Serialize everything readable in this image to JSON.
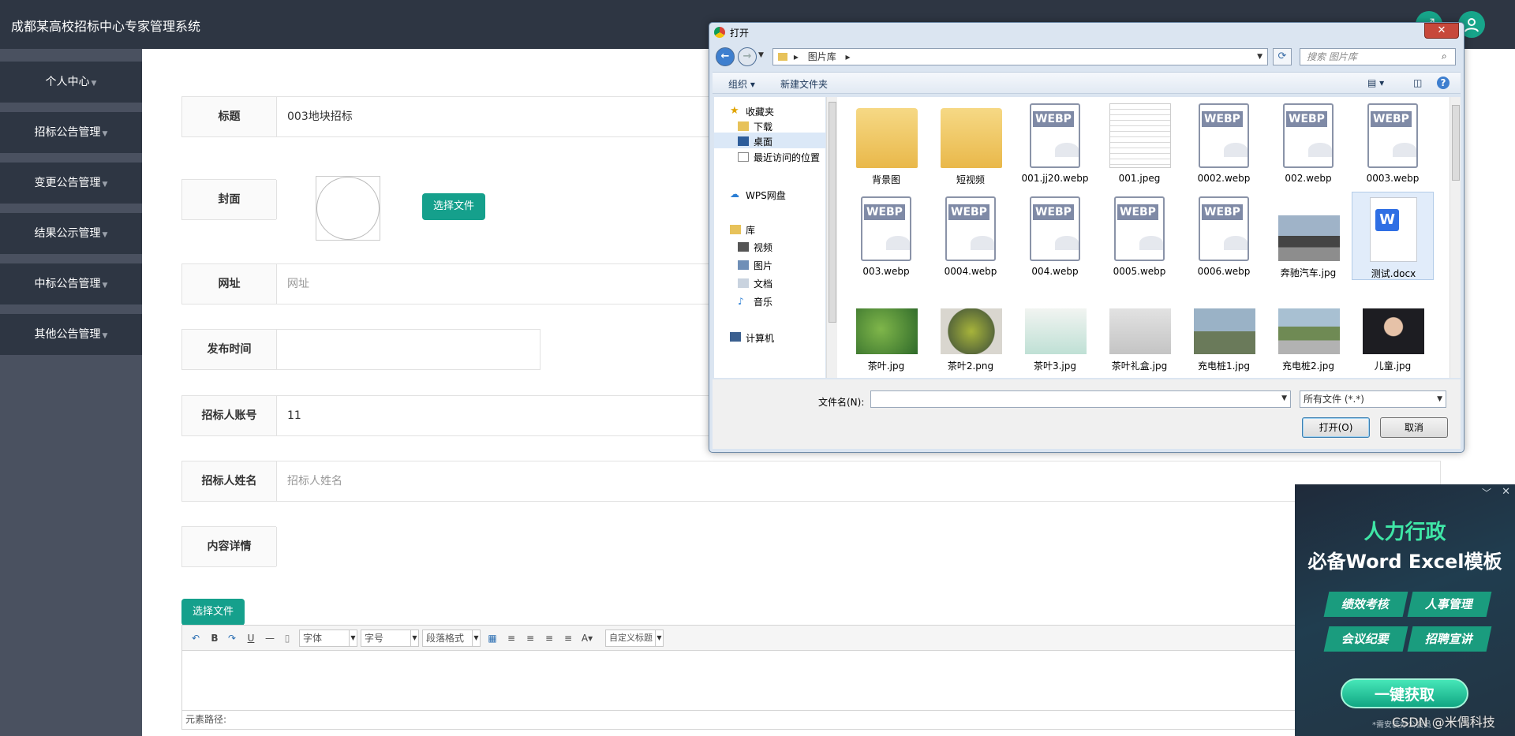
{
  "app": {
    "title": "成都某高校招标中心专家管理系统"
  },
  "sidebar": {
    "items": [
      {
        "label": "个人中心"
      },
      {
        "label": "招标公告管理"
      },
      {
        "label": "变更公告管理"
      },
      {
        "label": "结果公示管理"
      },
      {
        "label": "中标公告管理"
      },
      {
        "label": "其他公告管理"
      }
    ]
  },
  "form": {
    "title": {
      "label": "标题",
      "value": "003地块招标"
    },
    "cover": {
      "label": "封面",
      "button": "选择文件"
    },
    "url": {
      "label": "网址",
      "placeholder": "网址"
    },
    "publish_time": {
      "label": "发布时间",
      "value": ""
    },
    "account": {
      "label": "招标人账号",
      "value": "11"
    },
    "name": {
      "label": "招标人姓名",
      "placeholder": "招标人姓名"
    },
    "content": {
      "label": "内容详情",
      "button": "选择文件"
    }
  },
  "editor": {
    "font_select": "字体",
    "size_select": "字号",
    "para_select": "段落格式",
    "custom_select": "自定义标题",
    "footer": "元素路径:"
  },
  "dialog": {
    "title": "打开",
    "close": "✕",
    "breadcrumb": "图片库",
    "search_placeholder": "搜索 图片库",
    "organize": "组织 ▾",
    "new_folder": "新建文件夹",
    "nav": {
      "favorites": "收藏夹",
      "downloads": "下载",
      "desktop": "桌面",
      "recent": "最近访问的位置",
      "wps": "WPS网盘",
      "library": "库",
      "videos": "视频",
      "pictures": "图片",
      "documents": "文档",
      "music": "音乐",
      "computer": "计算机"
    },
    "files": [
      {
        "name": "背景图",
        "kind": "folder"
      },
      {
        "name": "短视频",
        "kind": "folder"
      },
      {
        "name": "001.jj20.webp",
        "kind": "webp"
      },
      {
        "name": "001.jpeg",
        "kind": "doc-image"
      },
      {
        "name": "0002.webp",
        "kind": "webp"
      },
      {
        "name": "002.webp",
        "kind": "webp"
      },
      {
        "name": "0003.webp",
        "kind": "webp"
      },
      {
        "name": "003.webp",
        "kind": "webp"
      },
      {
        "name": "0004.webp",
        "kind": "webp"
      },
      {
        "name": "004.webp",
        "kind": "webp"
      },
      {
        "name": "0005.webp",
        "kind": "webp"
      },
      {
        "name": "0006.webp",
        "kind": "webp"
      },
      {
        "name": "奔驰汽车.jpg",
        "kind": "photo-car"
      },
      {
        "name": "测试.docx",
        "kind": "word"
      },
      {
        "name": "茶叶.jpg",
        "kind": "photo-tea"
      },
      {
        "name": "茶叶2.png",
        "kind": "photo-tea2"
      },
      {
        "name": "茶叶3.jpg",
        "kind": "photo-box"
      },
      {
        "name": "茶叶礼盒.jpg",
        "kind": "photo-giftbox"
      },
      {
        "name": "充电桩1.jpg",
        "kind": "photo-charger"
      },
      {
        "name": "充电桩2.jpg",
        "kind": "photo-road"
      },
      {
        "name": "儿童.jpg",
        "kind": "photo-child"
      }
    ],
    "webp_label": "WEBP",
    "filename_label": "文件名(N):",
    "filename_value": "",
    "filter": "所有文件 (*.*)",
    "open_btn": "打开(O)",
    "cancel_btn": "取消"
  },
  "ad": {
    "title1": "人力行政",
    "title2": "必备Word Excel模板",
    "tags": [
      "绩效考核",
      "人事管理",
      "会议纪要",
      "招聘宣讲"
    ],
    "cta": "一键获取",
    "note": "*需安装办公会员"
  },
  "watermark": "CSDN @米偶科技",
  "colors": {
    "topbar": "#2e3643",
    "sidebar": "#4a5160",
    "accent": "#15a08c"
  }
}
